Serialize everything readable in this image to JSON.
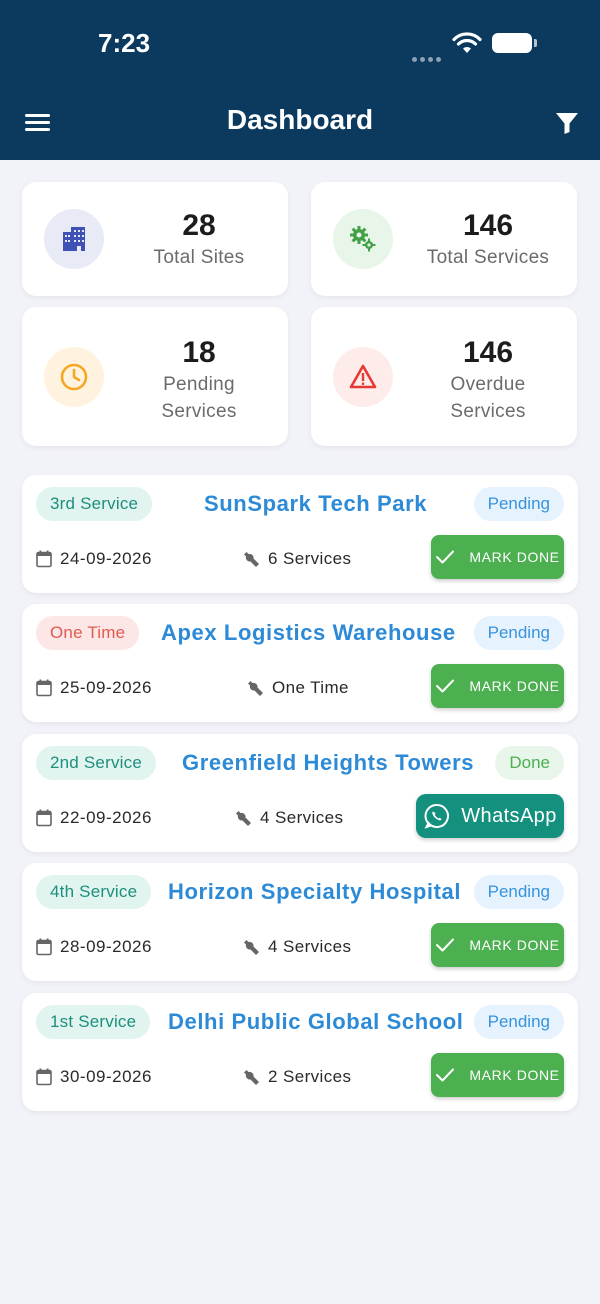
{
  "status_bar": {
    "time": "7:23"
  },
  "header": {
    "title": "Dashboard"
  },
  "stats": [
    {
      "value": "28",
      "label": "Total Sites",
      "icon": "building-icon",
      "color": "#3f51b5"
    },
    {
      "value": "146",
      "label": "Total Services",
      "icon": "gears-icon",
      "color": "#43a047"
    },
    {
      "value": "18",
      "label": "Pending Services",
      "label_line1": "Pending",
      "label_line2": "Services",
      "icon": "clock-icon",
      "color": "#f5a623"
    },
    {
      "value": "146",
      "label": "Overdue Services",
      "label_line1": "Overdue",
      "label_line2": "Services",
      "icon": "warning-icon",
      "color": "#e53935"
    }
  ],
  "services": [
    {
      "tag": "3rd Service",
      "tag_type": "green",
      "name": "SunSpark Tech Park",
      "status": "Pending",
      "date": "24-09-2026",
      "count": "6 Services",
      "action": "MARK DONE"
    },
    {
      "tag": "One Time",
      "tag_type": "red",
      "name": "Apex Logistics Warehouse",
      "status": "Pending",
      "date": "25-09-2026",
      "count": "One Time",
      "action": "MARK DONE"
    },
    {
      "tag": "2nd Service",
      "tag_type": "green",
      "name": "Greenfield Heights Towers",
      "status": "Done",
      "date": "22-09-2026",
      "count": "4 Services",
      "action": "WhatsApp"
    },
    {
      "tag": "4th Service",
      "tag_type": "green",
      "name": "Horizon Specialty Hospital",
      "status": "Pending",
      "date": "28-09-2026",
      "count": "4 Services",
      "action": "MARK DONE"
    },
    {
      "tag": "1st Service",
      "tag_type": "green",
      "name": "Delhi Public Global School",
      "status": "Pending",
      "date": "30-09-2026",
      "count": "2 Services",
      "action": "MARK DONE"
    }
  ],
  "colors": {
    "header_bg": "#0b3a5e",
    "page_bg": "#f2f3f8",
    "accent_blue": "#2d8ad6",
    "mark_done_green": "#4caf50",
    "whatsapp_teal": "#14907e"
  }
}
